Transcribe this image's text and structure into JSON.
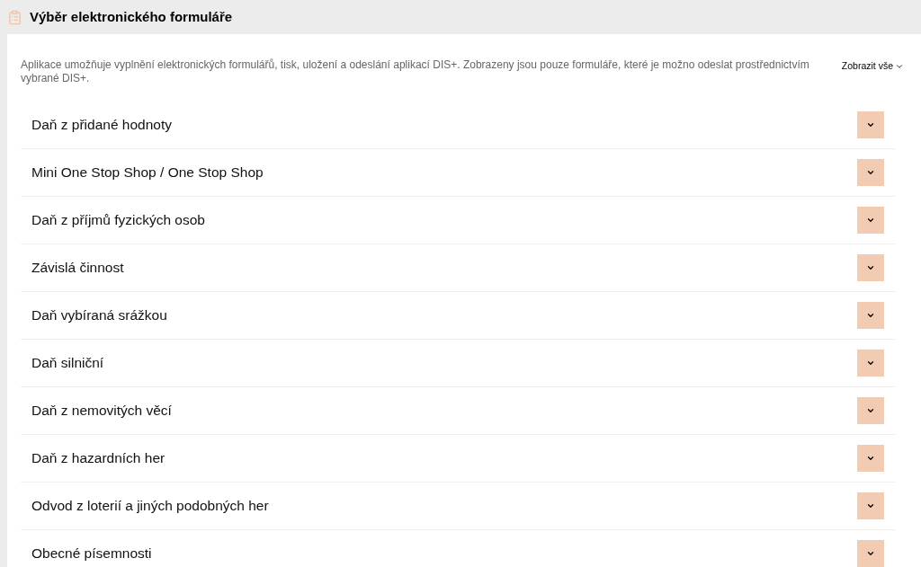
{
  "header": {
    "title": "Výběr elektronického formuláře"
  },
  "description": "Aplikace umožňuje vyplnění elektronických formulářů, tisk, uložení a odeslání aplikací DIS+. Zobrazeny jsou pouze formuláře, které je možno odeslat prostřednictvím vybrané DIS+.",
  "show_all": {
    "label": "Zobrazit vše",
    "expanded": false
  },
  "sections": [
    {
      "title": "Daň z přidané hodnoty",
      "expanded": false
    },
    {
      "title": "Mini One Stop Shop / One Stop Shop",
      "expanded": false
    },
    {
      "title": "Daň z příjmů fyzických osob",
      "expanded": false
    },
    {
      "title": "Závislá činnost",
      "expanded": false
    },
    {
      "title": "Daň vybíraná srážkou",
      "expanded": false
    },
    {
      "title": "Daň silniční",
      "expanded": false
    },
    {
      "title": "Daň z nemovitých věcí",
      "expanded": false
    },
    {
      "title": "Daň z hazardních her",
      "expanded": false
    },
    {
      "title": "Odvod z loterií a jiných podobných her",
      "expanded": false
    },
    {
      "title": "Obecné písemnosti",
      "expanded": false
    }
  ]
}
